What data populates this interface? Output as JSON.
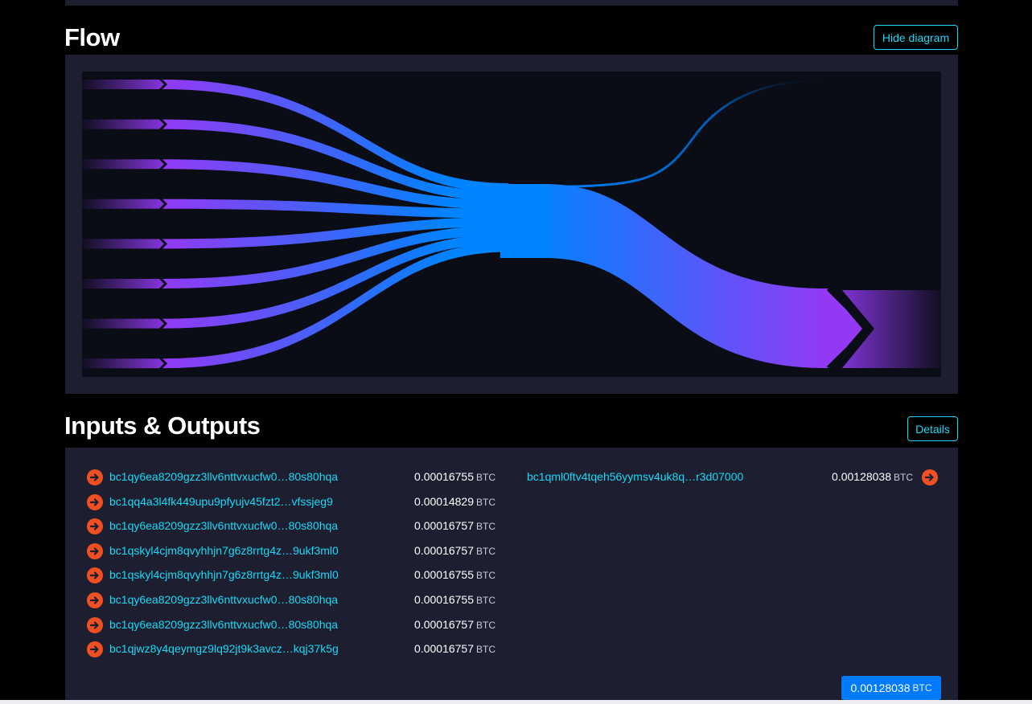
{
  "flow": {
    "title": "Flow",
    "hide_button": "Hide diagram"
  },
  "io": {
    "title": "Inputs & Outputs",
    "details_button": "Details",
    "inputs": [
      {
        "address": "bc1qy6ea8209gzz3llv6nttvxucfw0…80s80hqa",
        "amount": "0.00016755",
        "unit": "BTC"
      },
      {
        "address": "bc1qq4a3l4fk449upu9pfyujv45fzt2…vfssjeg9",
        "amount": "0.00014829",
        "unit": "BTC"
      },
      {
        "address": "bc1qy6ea8209gzz3llv6nttvxucfw0…80s80hqa",
        "amount": "0.00016757",
        "unit": "BTC"
      },
      {
        "address": "bc1qskyl4cjm8qvyhhjn7g6z8rrtg4z…9ukf3ml0",
        "amount": "0.00016757",
        "unit": "BTC"
      },
      {
        "address": "bc1qskyl4cjm8qvyhhjn7g6z8rrtg4z…9ukf3ml0",
        "amount": "0.00016755",
        "unit": "BTC"
      },
      {
        "address": "bc1qy6ea8209gzz3llv6nttvxucfw0…80s80hqa",
        "amount": "0.00016755",
        "unit": "BTC"
      },
      {
        "address": "bc1qy6ea8209gzz3llv6nttvxucfw0…80s80hqa",
        "amount": "0.00016757",
        "unit": "BTC"
      },
      {
        "address": "bc1qjwz8y4qeymgz9lq92jt9k3avcz…kqj37k5g",
        "amount": "0.00016757",
        "unit": "BTC"
      }
    ],
    "outputs": [
      {
        "address": "bc1qml0ftv4tqeh56yymsv4uk8q…r3d07000",
        "amount": "0.00128038",
        "unit": "BTC"
      }
    ],
    "total": {
      "amount": "0.00128038",
      "unit": "BTC"
    }
  },
  "colors": {
    "accent_cyan": "#1bd8f4",
    "input_arrow": "#f04f23",
    "flow_purple": "#9339f4",
    "flow_blue": "#0084ff",
    "panel": "#1d1f31"
  }
}
